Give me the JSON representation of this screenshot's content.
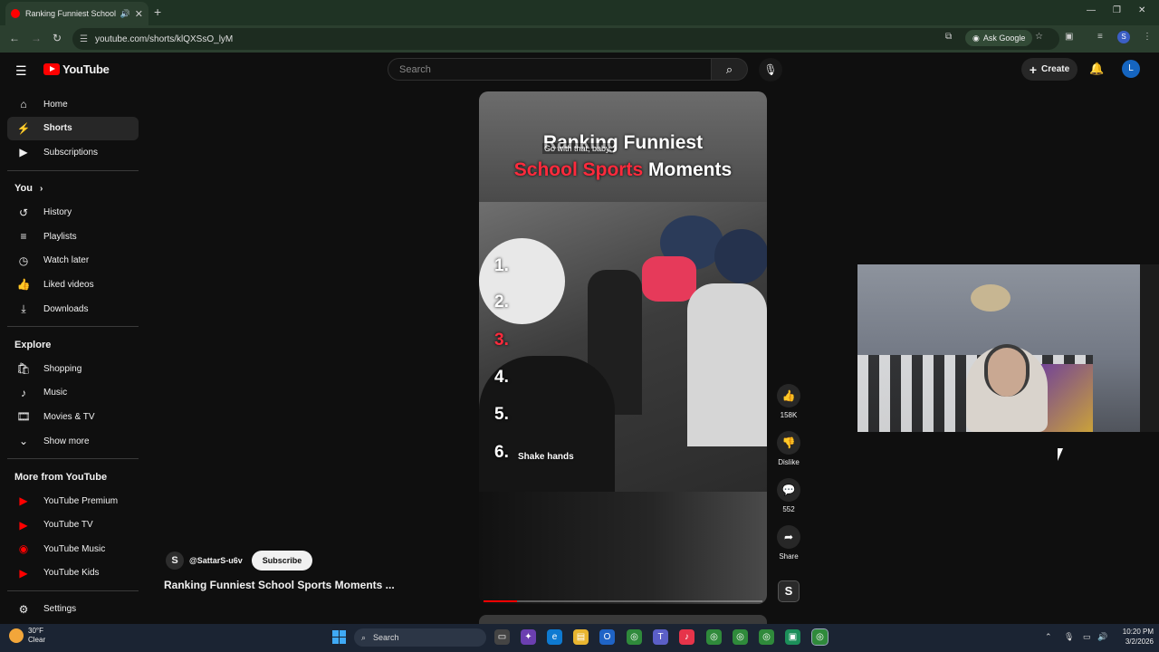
{
  "browser": {
    "tab_title": "Ranking Funniest School Sp",
    "url": "youtube.com/shorts/klQXSsO_lyM",
    "ask_google": "Ask Google",
    "profile_initial": "S"
  },
  "youtube": {
    "logo_text": "YouTube",
    "search_placeholder": "Search",
    "create_label": "Create",
    "avatar_initial": "L"
  },
  "sidebar": {
    "main": [
      {
        "label": "Home",
        "icon": "home-icon"
      },
      {
        "label": "Shorts",
        "icon": "shorts-icon",
        "active": true
      },
      {
        "label": "Subscriptions",
        "icon": "subscriptions-icon"
      }
    ],
    "you_heading": "You",
    "you": [
      {
        "label": "History",
        "icon": "history-icon"
      },
      {
        "label": "Playlists",
        "icon": "playlists-icon"
      },
      {
        "label": "Watch later",
        "icon": "clock-icon"
      },
      {
        "label": "Liked videos",
        "icon": "thumbs-up-icon"
      },
      {
        "label": "Downloads",
        "icon": "download-icon"
      }
    ],
    "explore_heading": "Explore",
    "explore": [
      {
        "label": "Shopping",
        "icon": "shopping-bag-icon"
      },
      {
        "label": "Music",
        "icon": "music-note-icon"
      },
      {
        "label": "Movies & TV",
        "icon": "film-icon"
      },
      {
        "label": "Show more",
        "icon": "chevron-down-icon"
      }
    ],
    "more_heading": "More from YouTube",
    "more": [
      {
        "label": "YouTube Premium",
        "icon": "youtube-premium-icon"
      },
      {
        "label": "YouTube TV",
        "icon": "youtube-tv-icon"
      },
      {
        "label": "YouTube Music",
        "icon": "youtube-music-icon"
      },
      {
        "label": "YouTube Kids",
        "icon": "youtube-kids-icon"
      }
    ],
    "settings": "Settings"
  },
  "video": {
    "caption": "Go with that, baby.",
    "title_line1": "Ranking Funniest",
    "title_line2_red": "School Sports",
    "title_line2_white": "Moments",
    "ranks": [
      "1.",
      "2.",
      "3.",
      "4.",
      "5.",
      "6."
    ],
    "rank6_label": "Shake hands",
    "progress": 0.12
  },
  "actions": {
    "likes": "158K",
    "dislike": "Dislike",
    "comments": "552",
    "share": "Share"
  },
  "channel": {
    "handle": "@SattarS-u6v",
    "subscribe": "Subscribe",
    "avatar_letter": "S",
    "short_title": "Ranking Funniest School Sports Moments ..."
  },
  "taskbar": {
    "temperature": "30°F",
    "condition": "Clear",
    "search": "Search",
    "time": "10:20 PM",
    "date": "3/2/2026"
  }
}
